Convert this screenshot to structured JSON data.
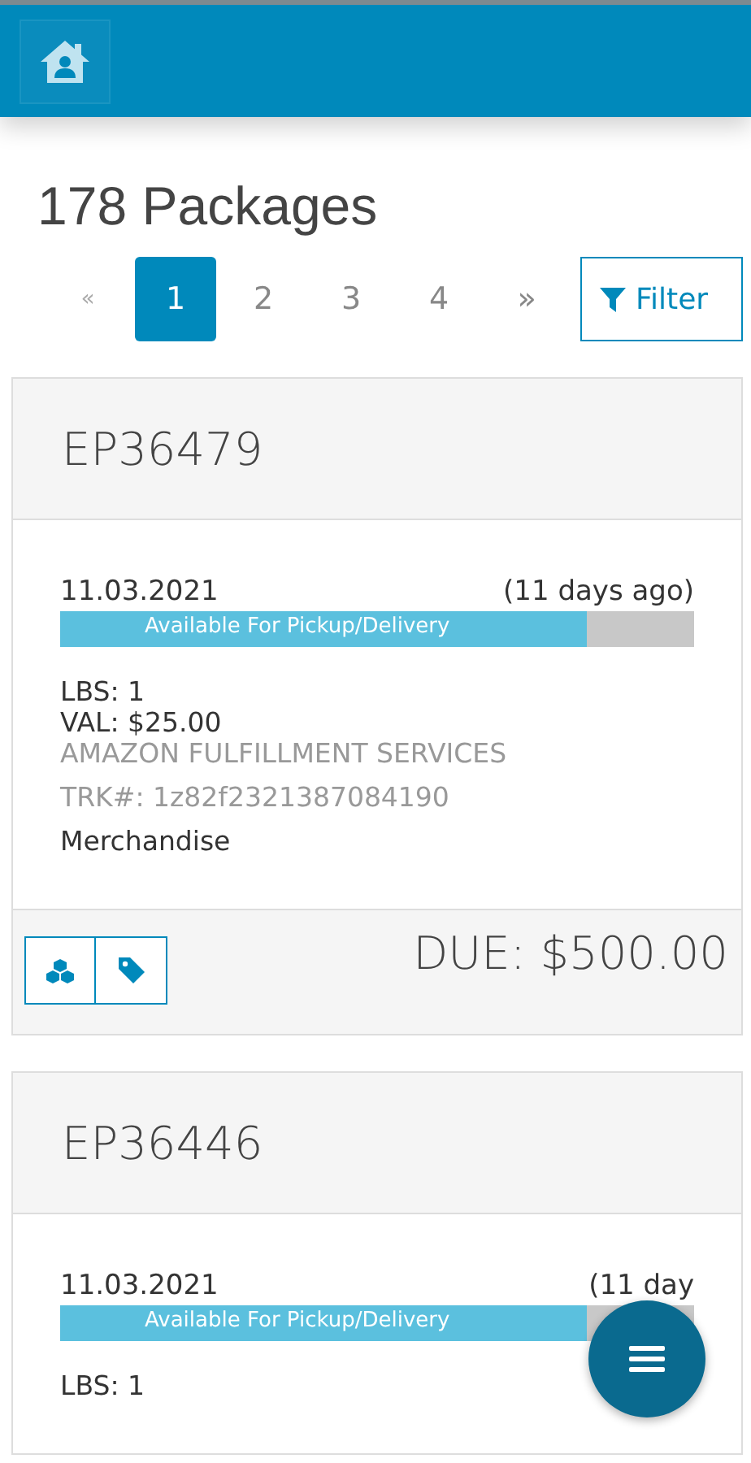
{
  "title": "178 Packages",
  "pagination": [
    {
      "label": "«",
      "selected": false,
      "disabled": true
    },
    {
      "label": "1",
      "selected": true,
      "disabled": false
    },
    {
      "label": "2",
      "selected": false,
      "disabled": false
    },
    {
      "label": "3",
      "selected": false,
      "disabled": false
    },
    {
      "label": "4",
      "selected": false,
      "disabled": false
    },
    {
      "label": "»",
      "selected": false,
      "disabled": false
    }
  ],
  "filter_button": "Filter",
  "packages": [
    {
      "id": "EP36479",
      "date": "11.03.2021",
      "age": "(11 days ago)",
      "status": "Available For Pickup/Delivery",
      "level": 0.83,
      "details": [
        {
          "kind": "plain",
          "text": "LBS: 1"
        },
        {
          "kind": "plain",
          "text": "VAL: $25.00"
        },
        {
          "kind": "muted",
          "text": "AMAZON FULFILLMENT SERVICES"
        },
        {
          "kind": "muted",
          "text": "TRK#: 1z82f2321387084190"
        },
        {
          "kind": "plain",
          "text": "Merchandise"
        }
      ],
      "due": "DUE: $500.00"
    },
    {
      "id": "EP36446",
      "date": "11.03.2021",
      "age": "(11 day",
      "status": "Available For Pickup/Delivery",
      "level": 0.83,
      "details": [
        {
          "kind": "plain",
          "text": "LBS: 1"
        }
      ]
    }
  ]
}
